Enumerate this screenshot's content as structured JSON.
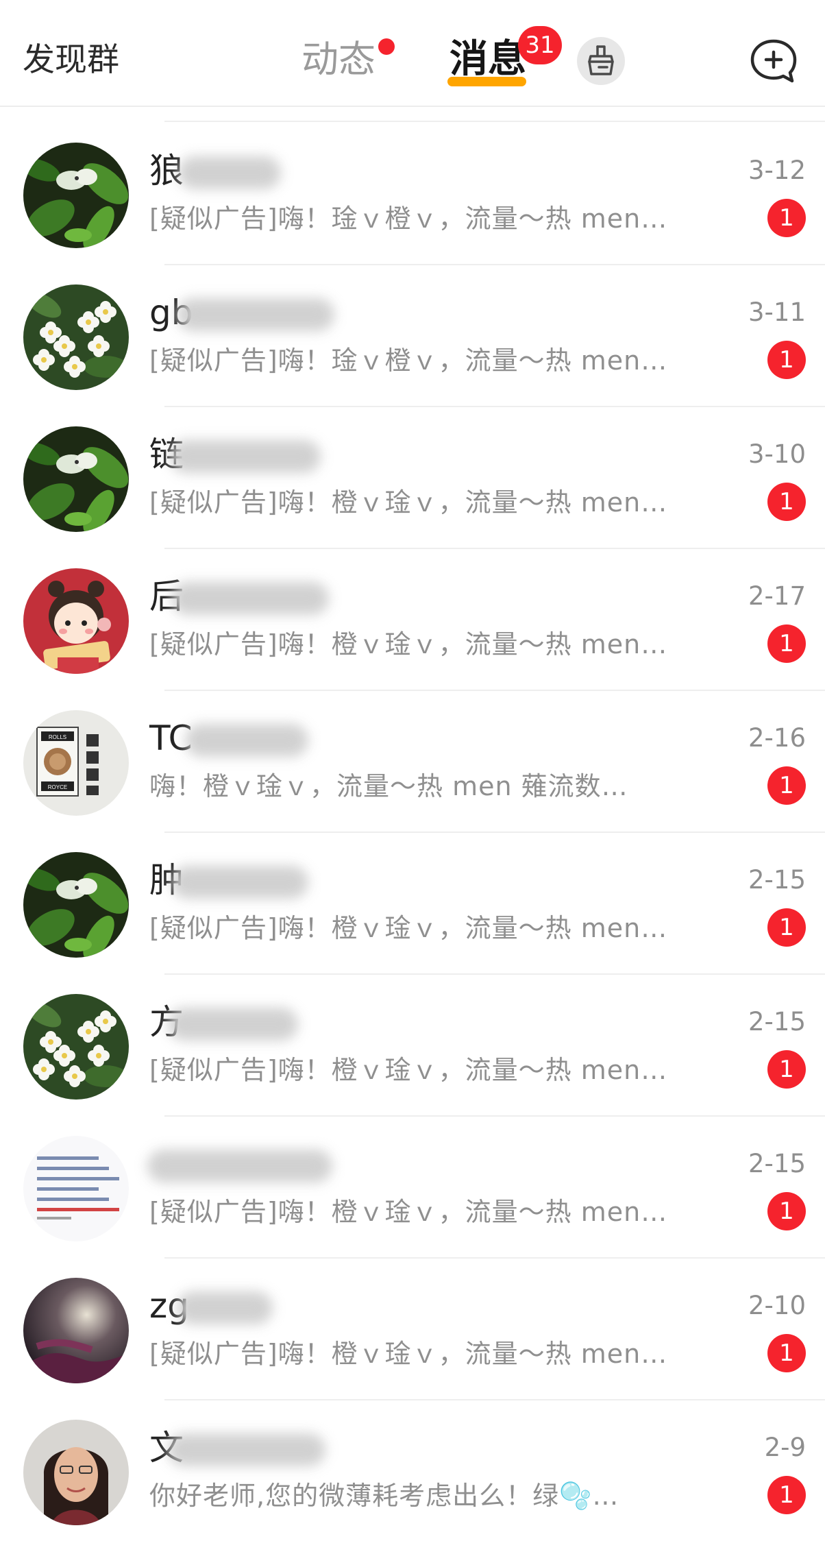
{
  "header": {
    "discover_label": "发现群",
    "tab_feed_label": "动态",
    "tab_messages_label": "消息",
    "messages_badge": "31",
    "accent_color": "#ffa500",
    "badge_color": "#f5232d",
    "cleaner_icon": "broom-icon",
    "new_chat_icon": "new-chat-plus-icon"
  },
  "conversations": [
    {
      "name": "狼",
      "date": "3-12",
      "preview": "[疑似广告]嗨！琻ｖ橙ｖ，流量～热 men…",
      "unread": "1",
      "avatar": "butterfly-leaves"
    },
    {
      "name": "gb",
      "date": "3-11",
      "preview": "[疑似广告]嗨！琻ｖ橙ｖ，流量～热 men…",
      "unread": "1",
      "avatar": "white-flowers"
    },
    {
      "name": "链",
      "date": "3-10",
      "preview": "[疑似广告]嗨！橙ｖ琻ｖ，流量～热 men…",
      "unread": "1",
      "avatar": "butterfly-leaves"
    },
    {
      "name": "后",
      "date": "2-17",
      "preview": "[疑似广告]嗨！橙ｖ琻ｖ，流量～热 men…",
      "unread": "1",
      "avatar": "cartoon-girl"
    },
    {
      "name": "TC",
      "date": "2-16",
      "preview": "嗨！橙ｖ琻ｖ，流量～热 men 薙流数…",
      "unread": "1",
      "avatar": "rolls-royce-lion",
      "avatar_text": "ROLLS ROYCE"
    },
    {
      "name": "肿",
      "date": "2-15",
      "preview": "[疑似广告]嗨！橙ｖ琻ｖ，流量～热 men…",
      "unread": "1",
      "avatar": "butterfly-leaves"
    },
    {
      "name": "方",
      "date": "2-15",
      "preview": "[疑似广告]嗨！橙ｖ琻ｖ，流量～热 men…",
      "unread": "1",
      "avatar": "white-flowers"
    },
    {
      "name": "",
      "date": "2-15",
      "preview": "[疑似广告]嗨！橙ｖ琻ｖ，流量～热 men…",
      "unread": "1",
      "avatar": "document"
    },
    {
      "name": "zg",
      "date": "2-10",
      "preview": "[疑似广告]嗨！橙ｖ琻ｖ，流量～热 men…",
      "unread": "1",
      "avatar": "dark-figure"
    },
    {
      "name": "文",
      "date": "2-9",
      "preview": "你好老师,您的微薄耗考虑出么！绿🫧…",
      "unread": "1",
      "avatar": "woman-portrait"
    }
  ]
}
